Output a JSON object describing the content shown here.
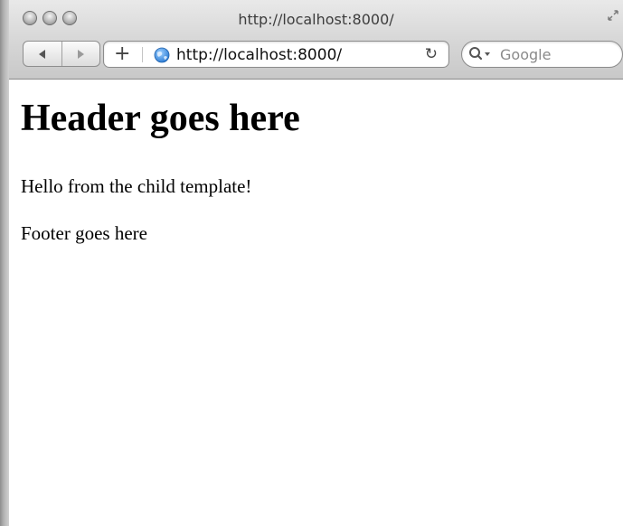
{
  "window": {
    "title": "http://localhost:8000/"
  },
  "toolbar": {
    "add_label": "+",
    "url": "http://localhost:8000/",
    "reload_label": "↻",
    "search_placeholder": "Google"
  },
  "page": {
    "heading": "Header goes here",
    "paragraphs": [
      "Hello from the child template!",
      "Footer goes here"
    ]
  },
  "colors": {
    "toolbar_top": "#e9e9e9",
    "toolbar_bottom": "#c8c8c8",
    "globe_blue": "#2f7fd6"
  },
  "icons": [
    "close-icon",
    "minimize-icon",
    "zoom-icon",
    "resize-icon",
    "back-icon",
    "forward-icon",
    "add-bookmark-icon",
    "globe-icon",
    "reload-icon",
    "search-icon"
  ]
}
